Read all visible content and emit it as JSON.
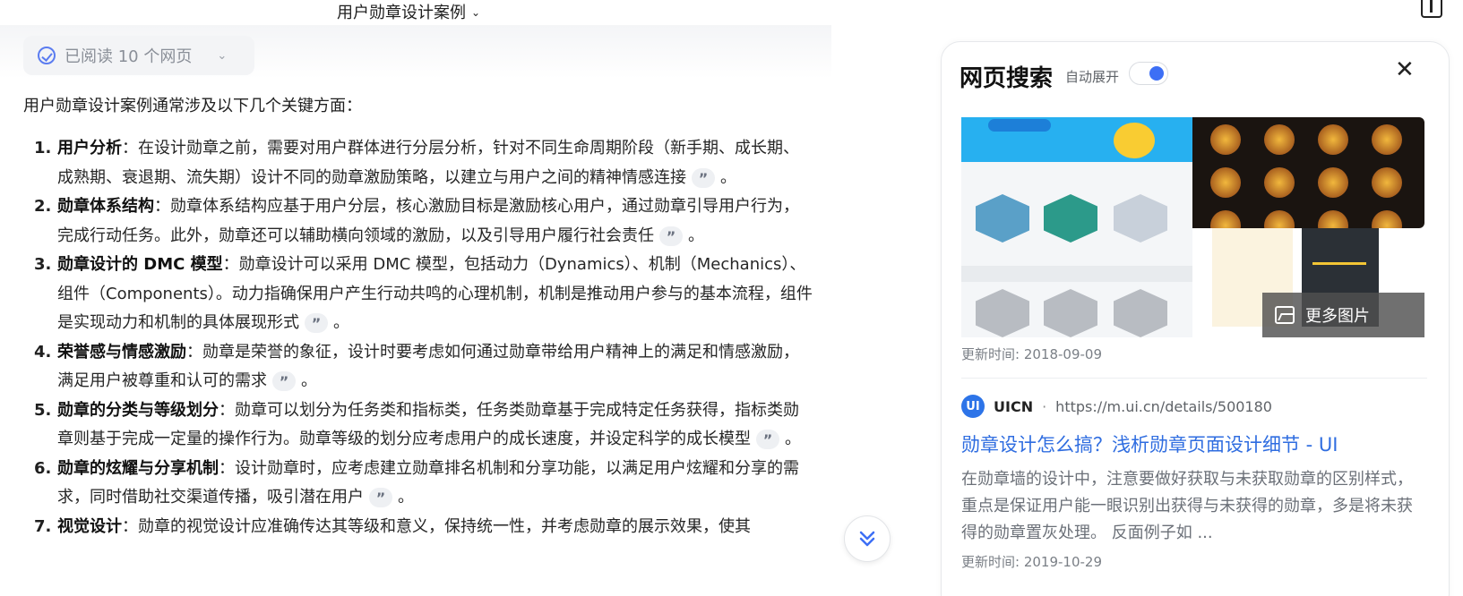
{
  "header": {
    "conversation_title": "用户勋章设计案例"
  },
  "chat": {
    "read_pill": "已阅读 10 个网页",
    "intro": "用户勋章设计案例通常涉及以下几个关键方面：",
    "items": [
      {
        "num": "1.",
        "term": "用户分析",
        "text": "：在设计勋章之前，需要对用户群体进行分层分析，针对不同生命周期阶段（新手期、成长期、成熟期、衰退期、流失期）设计不同的勋章激励策略，以建立与用户之间的精神情感连接",
        "tail": "。"
      },
      {
        "num": "2.",
        "term": "勋章体系结构",
        "text": "：勋章体系结构应基于用户分层，核心激励目标是激励核心用户，通过勋章引导用户行为，完成行动任务。此外，勋章还可以辅助横向领域的激励，以及引导用户履行社会责任",
        "tail": "。"
      },
      {
        "num": "3.",
        "term": "勋章设计的 DMC 模型",
        "text": "：勋章设计可以采用 DMC 模型，包括动力（Dynamics）、机制（Mechanics）、组件（Components）。动力指确保用户产生行动共鸣的心理机制，机制是推动用户参与的基本流程，组件是实现动力和机制的具体展现形式",
        "tail": "。"
      },
      {
        "num": "4.",
        "term": "荣誉感与情感激励",
        "text": "：勋章是荣誉的象征，设计时要考虑如何通过勋章带给用户精神上的满足和情感激励，满足用户被尊重和认可的需求",
        "tail": "。"
      },
      {
        "num": "5.",
        "term": "勋章的分类与等级划分",
        "text": "：勋章可以划分为任务类和指标类，任务类勋章基于完成特定任务获得，指标类勋章则基于完成一定量的操作行为。勋章等级的划分应考虑用户的成长速度，并设定科学的成长模型",
        "tail": "。"
      },
      {
        "num": "6.",
        "term": "勋章的炫耀与分享机制",
        "text": "：设计勋章时，应考虑建立勋章排名机制和分享功能，以满足用户炫耀和分享的需求，同时借助社交渠道传播，吸引潜在用户",
        "tail": "。"
      },
      {
        "num": "7.",
        "term": "视觉设计",
        "text": "：勋章的视觉设计应准确传达其等级和意义，保持统一性，并考虑勋章的展示效果，使其",
        "tail": ""
      }
    ],
    "cite_glyph": "”"
  },
  "panel": {
    "title": "网页搜索",
    "auto_expand_label": "自动展开",
    "auto_expand_on": true,
    "close_glyph": "✕",
    "more_images": "更多图片",
    "updated_1": "更新时间: 2018-09-09",
    "result": {
      "source_name": "UICN",
      "source_logo": "UI",
      "separator": "·",
      "url": "https://m.ui.cn/details/500180",
      "title": "勋章设计怎么搞？浅析勋章页面设计细节 - UI",
      "description": "在勋章墙的设计中，注意要做好获取与未获取勋章的区别样式，重点是保证用户能一眼识别出获得与未获得的勋章，多是将未获得的勋章置灰处理。 反面例子如 ...",
      "updated": "更新时间: 2019-10-29"
    }
  },
  "colors": {
    "accent": "#2f6de0",
    "toggle": "#3d6ff5"
  }
}
